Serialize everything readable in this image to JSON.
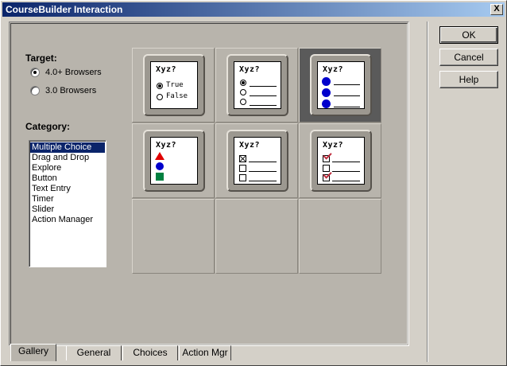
{
  "window": {
    "title": "CourseBuilder Interaction",
    "close_label": "X"
  },
  "target": {
    "label": "Target:",
    "options": [
      {
        "label": "4.0+ Browsers",
        "selected": true
      },
      {
        "label": "3.0 Browsers",
        "selected": false
      }
    ]
  },
  "category": {
    "label": "Category:",
    "items": [
      "Multiple Choice",
      "Drag and Drop",
      "Explore",
      "Button",
      "Text Entry",
      "Timer",
      "Slider",
      "Action Manager"
    ],
    "selected_index": 0
  },
  "gallery": {
    "card_title": "Xyz?",
    "true_label": "True",
    "false_label": "False"
  },
  "tabs": [
    "Gallery",
    "General",
    "Choices",
    "Action Mgr"
  ],
  "buttons": {
    "ok": "OK",
    "cancel": "Cancel",
    "help": "Help"
  }
}
